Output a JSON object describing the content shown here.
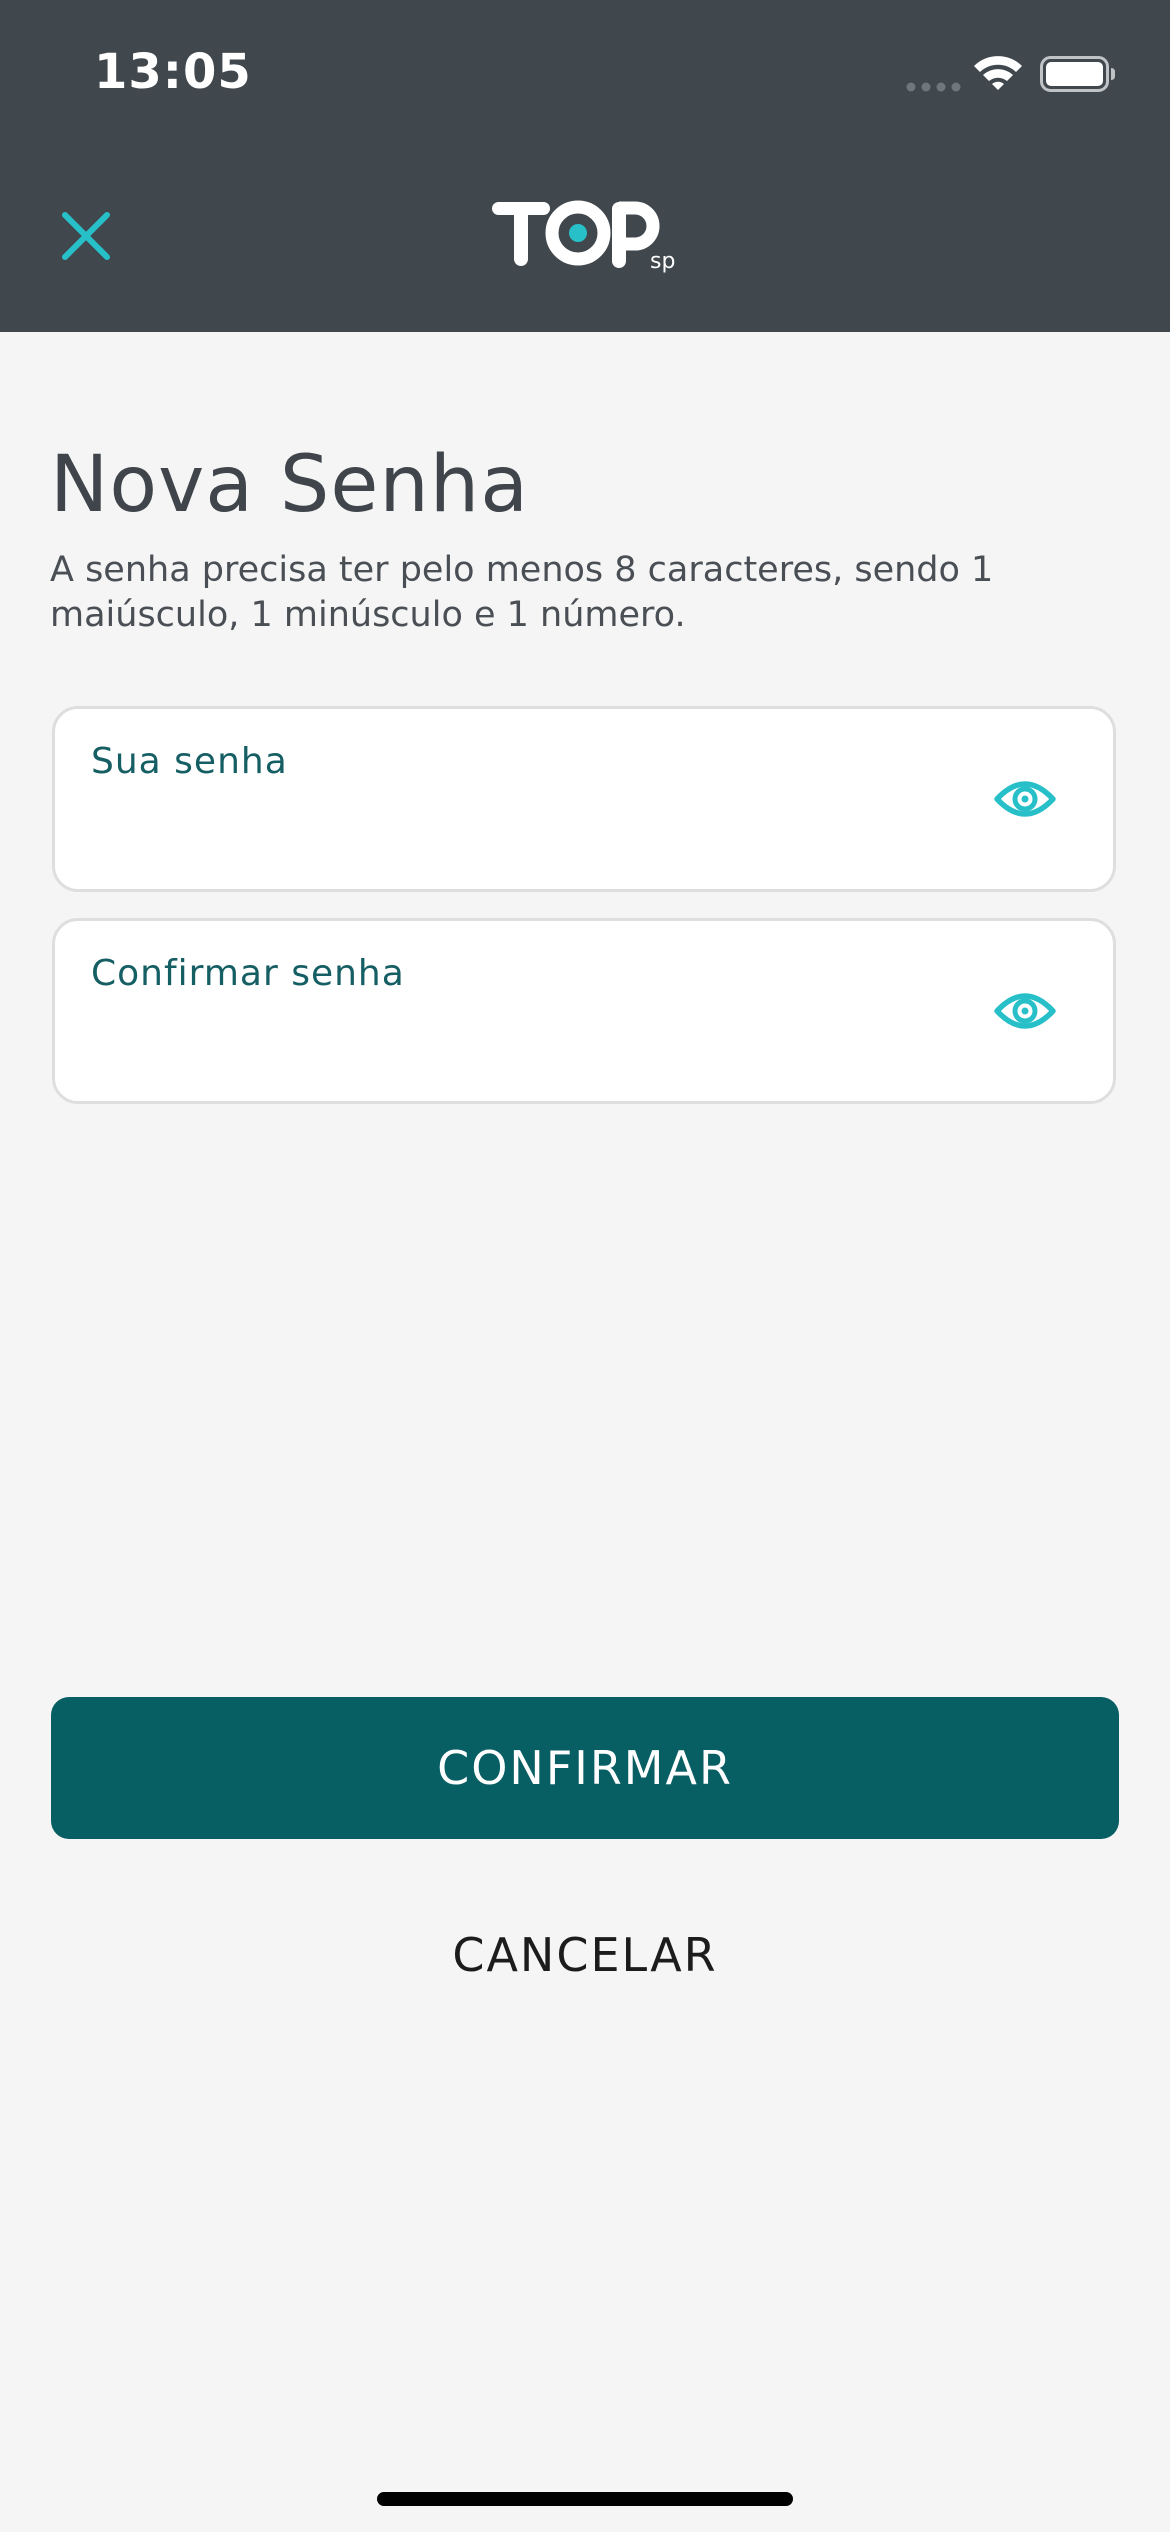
{
  "status_bar": {
    "time": "13:05",
    "icons": [
      "signal-icon",
      "wifi-icon",
      "battery-icon"
    ]
  },
  "header": {
    "close_icon": "close-icon",
    "logo": {
      "main": "TOP",
      "suffix": "sp"
    }
  },
  "main": {
    "title": "Nova Senha",
    "description": "A senha precisa ter pelo menos 8 caracteres, sendo 1 maiúsculo, 1 minúsculo e 1 número.",
    "fields": [
      {
        "label": "Sua senha",
        "value": "",
        "icon": "eye-icon"
      },
      {
        "label": "Confirmar senha",
        "value": "",
        "icon": "eye-icon"
      }
    ]
  },
  "actions": {
    "confirm_label": "CONFIRMAR",
    "cancel_label": "CANCELAR"
  },
  "colors": {
    "header_bg": "#40474d",
    "accent": "#27c0c9",
    "primary": "#075e63",
    "background": "#f5f5f5"
  }
}
